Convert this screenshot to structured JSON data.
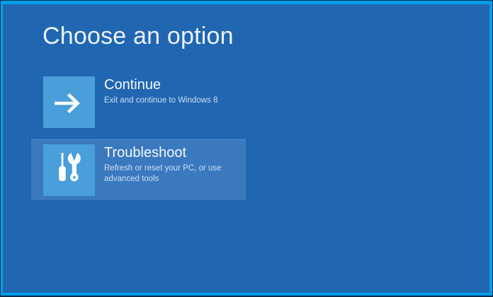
{
  "screen": {
    "title": "Choose an option",
    "options": [
      {
        "id": "continue",
        "label": "Continue",
        "description": "Exit and continue to Windows 8",
        "icon": "arrow-right-icon",
        "highlighted": false
      },
      {
        "id": "troubleshoot",
        "label": "Troubleshoot",
        "description": "Refresh or reset your PC, or use advanced tools",
        "icon": "tools-icon",
        "highlighted": true
      }
    ]
  },
  "colors": {
    "background": "#2166b1",
    "frame_border": "#059ee8",
    "outer_edge": "#0a2d50",
    "icon_tile": "#4a9ed9",
    "highlighted_row": "#3b79bf",
    "title_text": "#eaf4fc",
    "label_text": "#f2f8fd",
    "description_text": "#c9e0f4"
  }
}
